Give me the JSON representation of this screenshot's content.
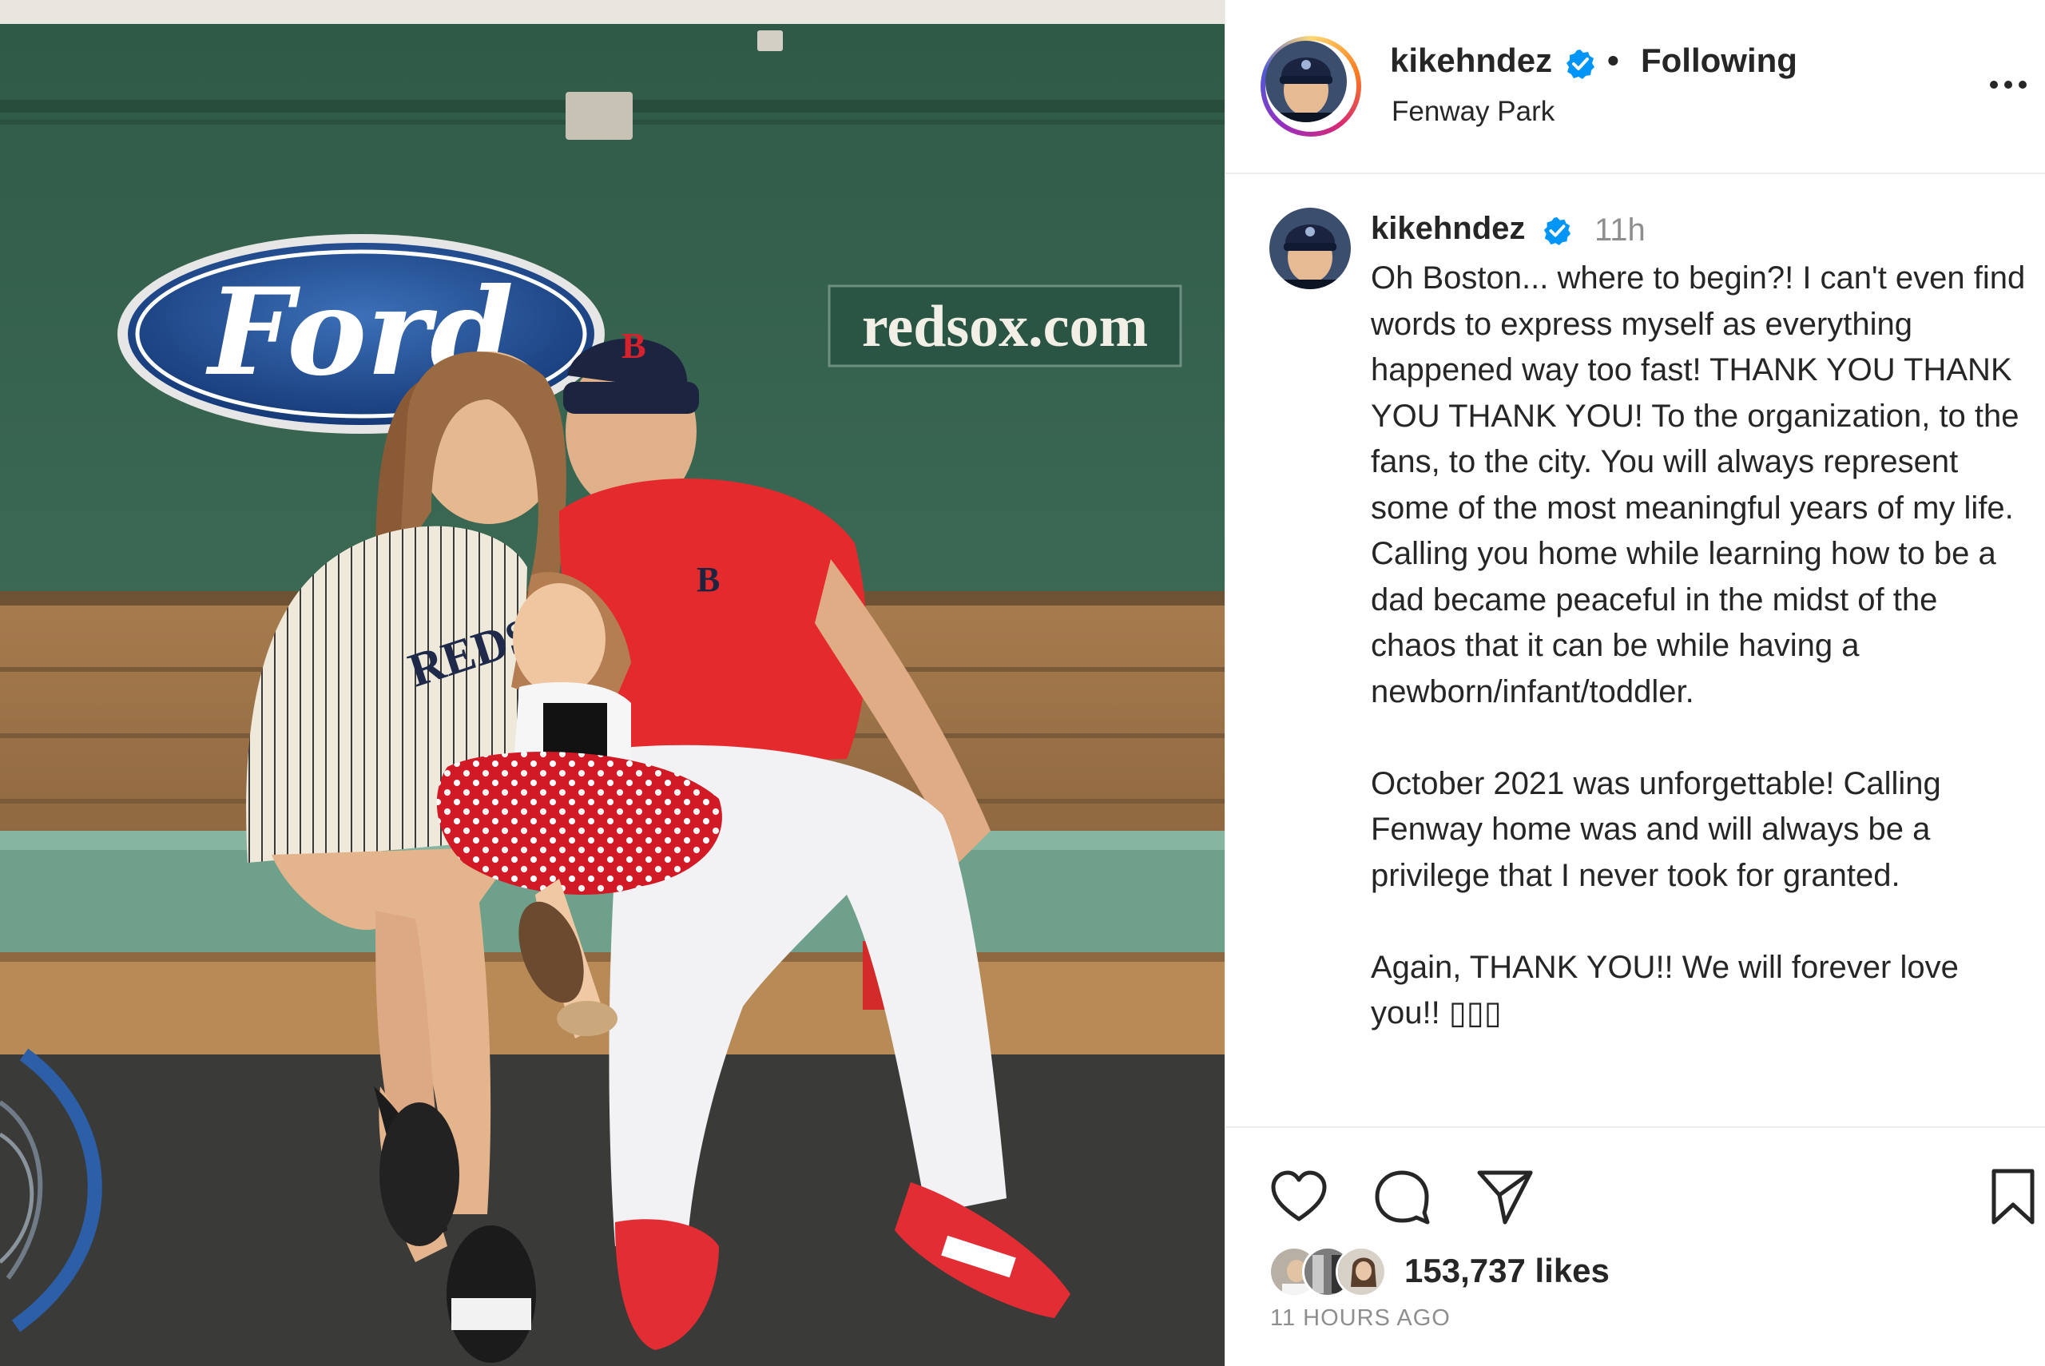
{
  "post": {
    "photo_signs": {
      "ford_logo": "Ford",
      "website_sign": "redsox.com",
      "shirt_text": "REDS"
    }
  },
  "header": {
    "username": "kikehndez",
    "verified_icon": "verified-badge-icon",
    "separator": "•",
    "follow_status": "Following",
    "location": "Fenway Park",
    "more_icon": "more-options-icon"
  },
  "caption": {
    "username": "kikehndez",
    "time": "11h",
    "text": "Oh Boston... where to begin?! I can't even find words to express myself as everything happened way too fast! THANK YOU THANK YOU THANK YOU! To the organization, to the fans, to the city. You will always represent some of the most meaningful years of my life. Calling you home while learning how to be a dad became peaceful in the midst of the chaos that it can be while having a newborn/infant/toddler.\n\nOctober 2021 was unforgettable! Calling Fenway home was and will always be a privilege that I never took for granted.\n\nAgain, THANK YOU!! We will forever love you!! ▯▯▯"
  },
  "actions": {
    "like_icon": "heart-icon",
    "comment_icon": "comment-icon",
    "share_icon": "share-icon",
    "save_icon": "bookmark-icon",
    "likes": "153,737 likes",
    "timestamp": "11 HOURS AGO"
  },
  "colors": {
    "accent_blue": "#0095f6",
    "text": "#262626",
    "muted": "#8e8e8e",
    "divider": "#ececec"
  }
}
